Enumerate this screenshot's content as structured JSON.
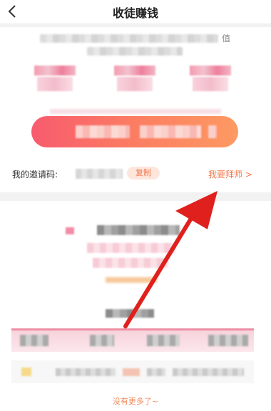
{
  "header": {
    "title": "收徒赚钱",
    "back_icon": "chevron-left-icon"
  },
  "invite": {
    "value_char": "值",
    "label": "我的邀请码:",
    "copy_label": "复制",
    "master_link": "我要拜师 >"
  },
  "footer": {
    "no_more": "没有更多了~"
  },
  "colors": {
    "accent": "#f07a4f",
    "cta_start": "#f85b6e",
    "cta_end": "#fd9a62",
    "arrow": "#e0201c"
  }
}
